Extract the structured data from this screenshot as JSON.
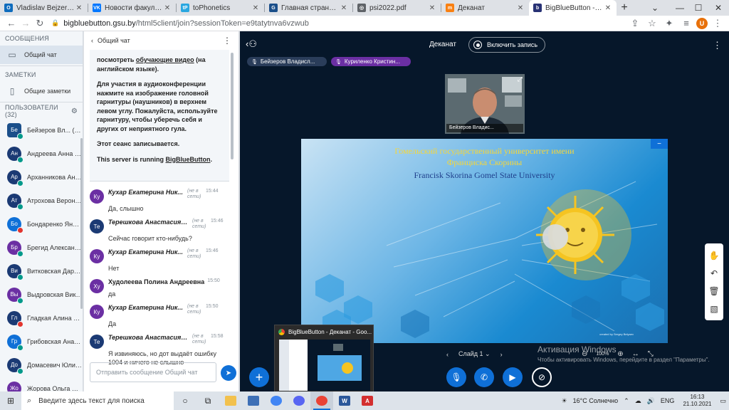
{
  "browser": {
    "tabs": [
      {
        "title": "Vladislav Bejzerov - Outlo",
        "favicon": "outlook-icon",
        "color": "#0f6cbd",
        "glyph": "O",
        "active": false
      },
      {
        "title": "Новости факультета пс",
        "favicon": "vk-icon",
        "color": "#0077ff",
        "glyph": "VK",
        "active": false
      },
      {
        "title": "toPhonetics",
        "favicon": "tophonetics-icon",
        "color": "#2aa7e0",
        "glyph": "tP",
        "active": false
      },
      {
        "title": "Главная страница | Гом",
        "favicon": "gsu-icon",
        "color": "#1b4f8a",
        "glyph": "G",
        "active": false
      },
      {
        "title": "psi2022.pdf",
        "favicon": "globe-icon",
        "color": "#5f6368",
        "glyph": "◎",
        "active": false
      },
      {
        "title": "Деканат",
        "favicon": "moodle-icon",
        "color": "#f98012",
        "glyph": "m",
        "active": false
      },
      {
        "title": "BigBlueButton - Дек",
        "favicon": "bigbluebutton-icon",
        "color": "#283274",
        "glyph": "b",
        "active": true
      }
    ],
    "url_host": "bigbluebutton.gsu.by",
    "url_path": "/html5client/join?sessionToken=e9tatytnva6vzwub",
    "profile_initial": "U"
  },
  "userlist": {
    "messages_heading": "СООБЩЕНИЯ",
    "public_chat_label": "Общий чат",
    "notes_heading": "ЗАМЕТКИ",
    "shared_notes_label": "Общие заметки",
    "users_heading": "ПОЛЬЗОВАТЕЛИ (32)",
    "users": [
      {
        "initials": "Бе",
        "name": "Бейзеров Вл... (Вы)",
        "color": "#1b4f8a",
        "presenter": true,
        "muted": false
      },
      {
        "initials": "Ан",
        "name": "Андреева Анна Д...",
        "color": "#1b3a74",
        "presenter": false,
        "muted": false
      },
      {
        "initials": "Ар",
        "name": "Арханникова Анк...",
        "color": "#1b3a74",
        "presenter": false,
        "muted": false
      },
      {
        "initials": "Ат",
        "name": "Атрохова Верони...",
        "color": "#1b3a74",
        "presenter": false,
        "muted": false
      },
      {
        "initials": "Бо",
        "name": "Бондаренко Яна ...",
        "color": "#0f70d7",
        "presenter": false,
        "muted": true
      },
      {
        "initials": "Бр",
        "name": "Брегид Александ...",
        "color": "#6b2fa3",
        "presenter": false,
        "muted": false
      },
      {
        "initials": "Ви",
        "name": "Витковская Дарь...",
        "color": "#1b3a74",
        "presenter": false,
        "muted": false
      },
      {
        "initials": "Вы",
        "name": "Выдровская Викт...",
        "color": "#6b2fa3",
        "presenter": false,
        "muted": false
      },
      {
        "initials": "Гл",
        "name": "Гладкая Алина Н...",
        "color": "#1b3a74",
        "presenter": false,
        "muted": true
      },
      {
        "initials": "Гр",
        "name": "Грибовская Анаст...",
        "color": "#0f70d7",
        "presenter": false,
        "muted": false
      },
      {
        "initials": "До",
        "name": "Домасевич Юлия ...",
        "color": "#1b3a74",
        "presenter": false,
        "muted": false
      },
      {
        "initials": "Жо",
        "name": "Жорова Ольга Се...",
        "color": "#6b2fa3",
        "presenter": false,
        "muted": false
      }
    ]
  },
  "chat": {
    "title": "Общий чат",
    "welcome": {
      "p1_pre": "посмотреть ",
      "p1_link": "обучающие видео",
      "p1_post": " (на английском языке).",
      "p2_normal": "Для участия в аудиоконференции нажмите на изображение головной гарнитуры (наушников) в верхнем левом углу. ",
      "p2_bold": "Пожалуйста, используйте гарнитуру, чтобы уберечь себя и других от неприятного гула.",
      "p3": "Этот сеанс записывается.",
      "p4_pre": "This server is running ",
      "p4_link": "BigBlueButton",
      "p4_post": "."
    },
    "offline_label": "(не в сети)",
    "messages": [
      {
        "initials": "Ку",
        "author": "Кухар Екатерина Ник...",
        "color": "#6b2fa3",
        "time": "15:44",
        "offline": true,
        "text": "Да, слышно"
      },
      {
        "initials": "Те",
        "author": "Терешкова Анастасия ...",
        "color": "#1b3a74",
        "time": "15:46",
        "offline": true,
        "text": "Сейчас говорит кто-нибудь?"
      },
      {
        "initials": "Ку",
        "author": "Кухар Екатерина Ник...",
        "color": "#6b2fa3",
        "time": "15:46",
        "offline": true,
        "text": "Нет"
      },
      {
        "initials": "Ху",
        "author": "Худолеева Полина Андреевна",
        "color": "#6b2fa3",
        "time": "15:50",
        "offline": false,
        "text": "да"
      },
      {
        "initials": "Ку",
        "author": "Кухар Екатерина Ник...",
        "color": "#6b2fa3",
        "time": "15:50",
        "offline": true,
        "text": "Да"
      },
      {
        "initials": "Те",
        "author": "Терешкова Анастасия ...",
        "color": "#1b3a74",
        "time": "15:58",
        "offline": true,
        "text": "Я извиняюсь, но дот выдаёт ошибку 1004 и ничего не слышно"
      }
    ],
    "input_placeholder": "Отправить сообщение Общий чат"
  },
  "main": {
    "meeting_title": "Деканат",
    "record_label": "Включить запись",
    "talkers": [
      {
        "name": "Бейзеров Владисл...",
        "color": "#2a3d5a",
        "muted": false
      },
      {
        "name": "Куриленко Кристин...",
        "color": "#6b2fa3",
        "muted": false
      }
    ],
    "webcam_name": "Бейзеров Владис...",
    "slide": {
      "line1": "Гомельский государственный университет имени",
      "line2": "Франциска Скорины",
      "line3": "Francisk Skorina Gomel State University",
      "credit": "created by Sergey Belyaev"
    },
    "slide_label": "Слайд 1",
    "zoom_label": "100%",
    "activation_line1": "Активация Windows",
    "activation_line2": "Чтобы активировать Windows, перейдите в раздел \"Параметры\"."
  },
  "preview": {
    "title": "BigBlueButton - Деканат - Goo..."
  },
  "taskbar": {
    "search_placeholder": "Введите здесь текст для поиска",
    "weather": "16°C Солнечно",
    "lang": "ENG",
    "time": "16:13",
    "date": "21.10.2021"
  }
}
